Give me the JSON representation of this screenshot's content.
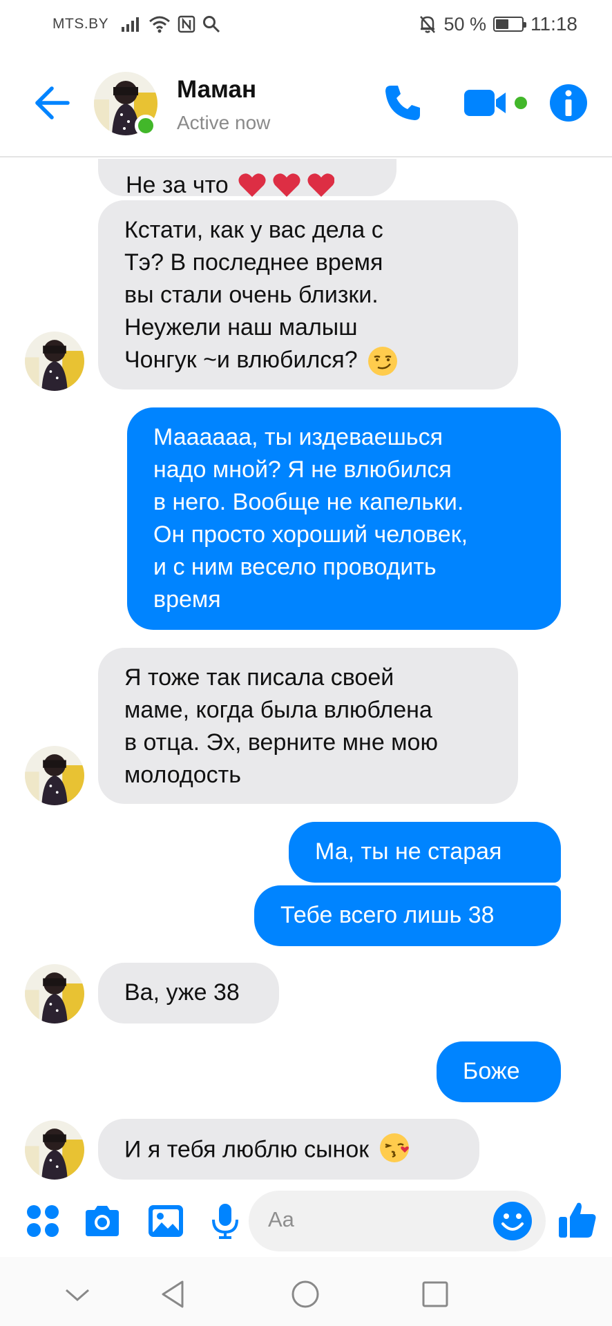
{
  "status_bar": {
    "carrier": "MTS.BY",
    "battery": "50 %",
    "battery_level": 0.5,
    "time": "11:18"
  },
  "header": {
    "name": "Маман",
    "status": "Active now"
  },
  "messages": [
    {
      "dir": "in",
      "text": "Не за что",
      "emoji": "heart-emoji-x3"
    },
    {
      "dir": "in",
      "text": "Кстати, как у вас дела с\nТэ? В последнее время\nвы стали очень близки.\nНеужели наш малыш\nЧонгук ~и влюбился?",
      "emoji": "smirk-emoji"
    },
    {
      "dir": "out",
      "text": "Маааааа,  ты издеваешься\nнадо мной? Я не влюбился\nв него. Вообще не капельки.\nОн просто хороший человек,\nи с ним весело проводить\nвремя"
    },
    {
      "dir": "in",
      "text": "Я тоже так писала своей\nмаме, когда была влюблена\nв отца. Эх, верните мне мою\nмолодость"
    },
    {
      "dir": "out",
      "text": "Ма, ты не старая"
    },
    {
      "dir": "out",
      "text": "Тебе всего лишь 38"
    },
    {
      "dir": "in",
      "text": "Ва, уже 38"
    },
    {
      "dir": "out",
      "text": "Боже"
    },
    {
      "dir": "in",
      "text": "И я тебя люблю сынок",
      "emoji": "kiss-emoji"
    }
  ],
  "composer": {
    "placeholder": "Aa"
  },
  "colors": {
    "accent": "#0084ff",
    "incoming_bubble": "#e9e9eb",
    "online": "#42b72a"
  }
}
